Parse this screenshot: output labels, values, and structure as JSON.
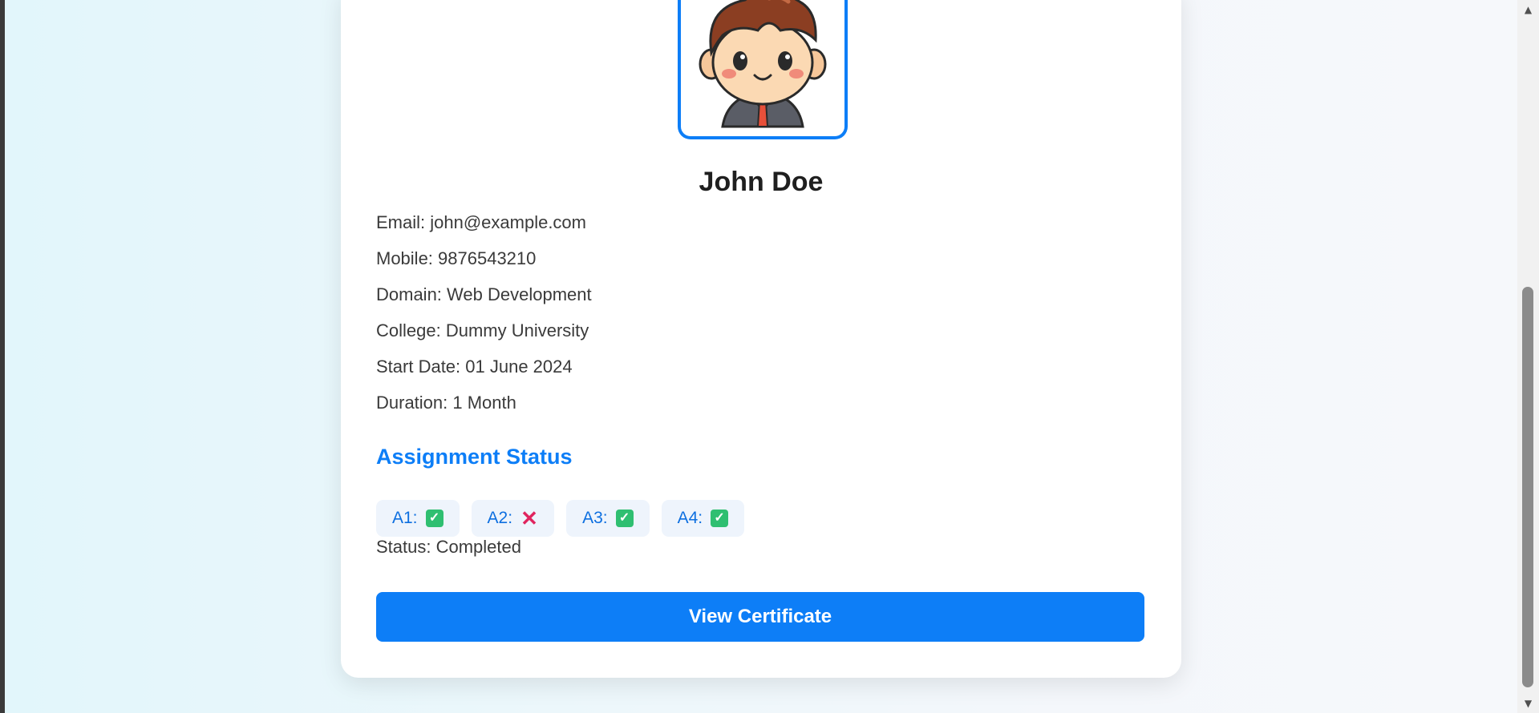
{
  "profile": {
    "name": "John Doe",
    "email": "Email: john@example.com",
    "mobile": "Mobile: 9876543210",
    "domain": "Domain: Web Development",
    "college": "College: Dummy University",
    "start_date": "Start Date: 01 June 2024",
    "duration": "Duration: 1 Month"
  },
  "assignments": {
    "title": "Assignment Status",
    "items": [
      {
        "label": "A1:",
        "status": "pass",
        "icon": "check-mark-icon"
      },
      {
        "label": "A2:",
        "status": "fail",
        "icon": "cross-mark-icon"
      },
      {
        "label": "A3:",
        "status": "pass",
        "icon": "check-mark-icon"
      },
      {
        "label": "A4:",
        "status": "pass",
        "icon": "check-mark-icon"
      }
    ]
  },
  "status_text": "Status: Completed",
  "actions": {
    "view_certificate": "View Certificate"
  },
  "colors": {
    "accent": "#0d7ef7",
    "pass": "#2fbf71",
    "fail": "#e0245e"
  }
}
